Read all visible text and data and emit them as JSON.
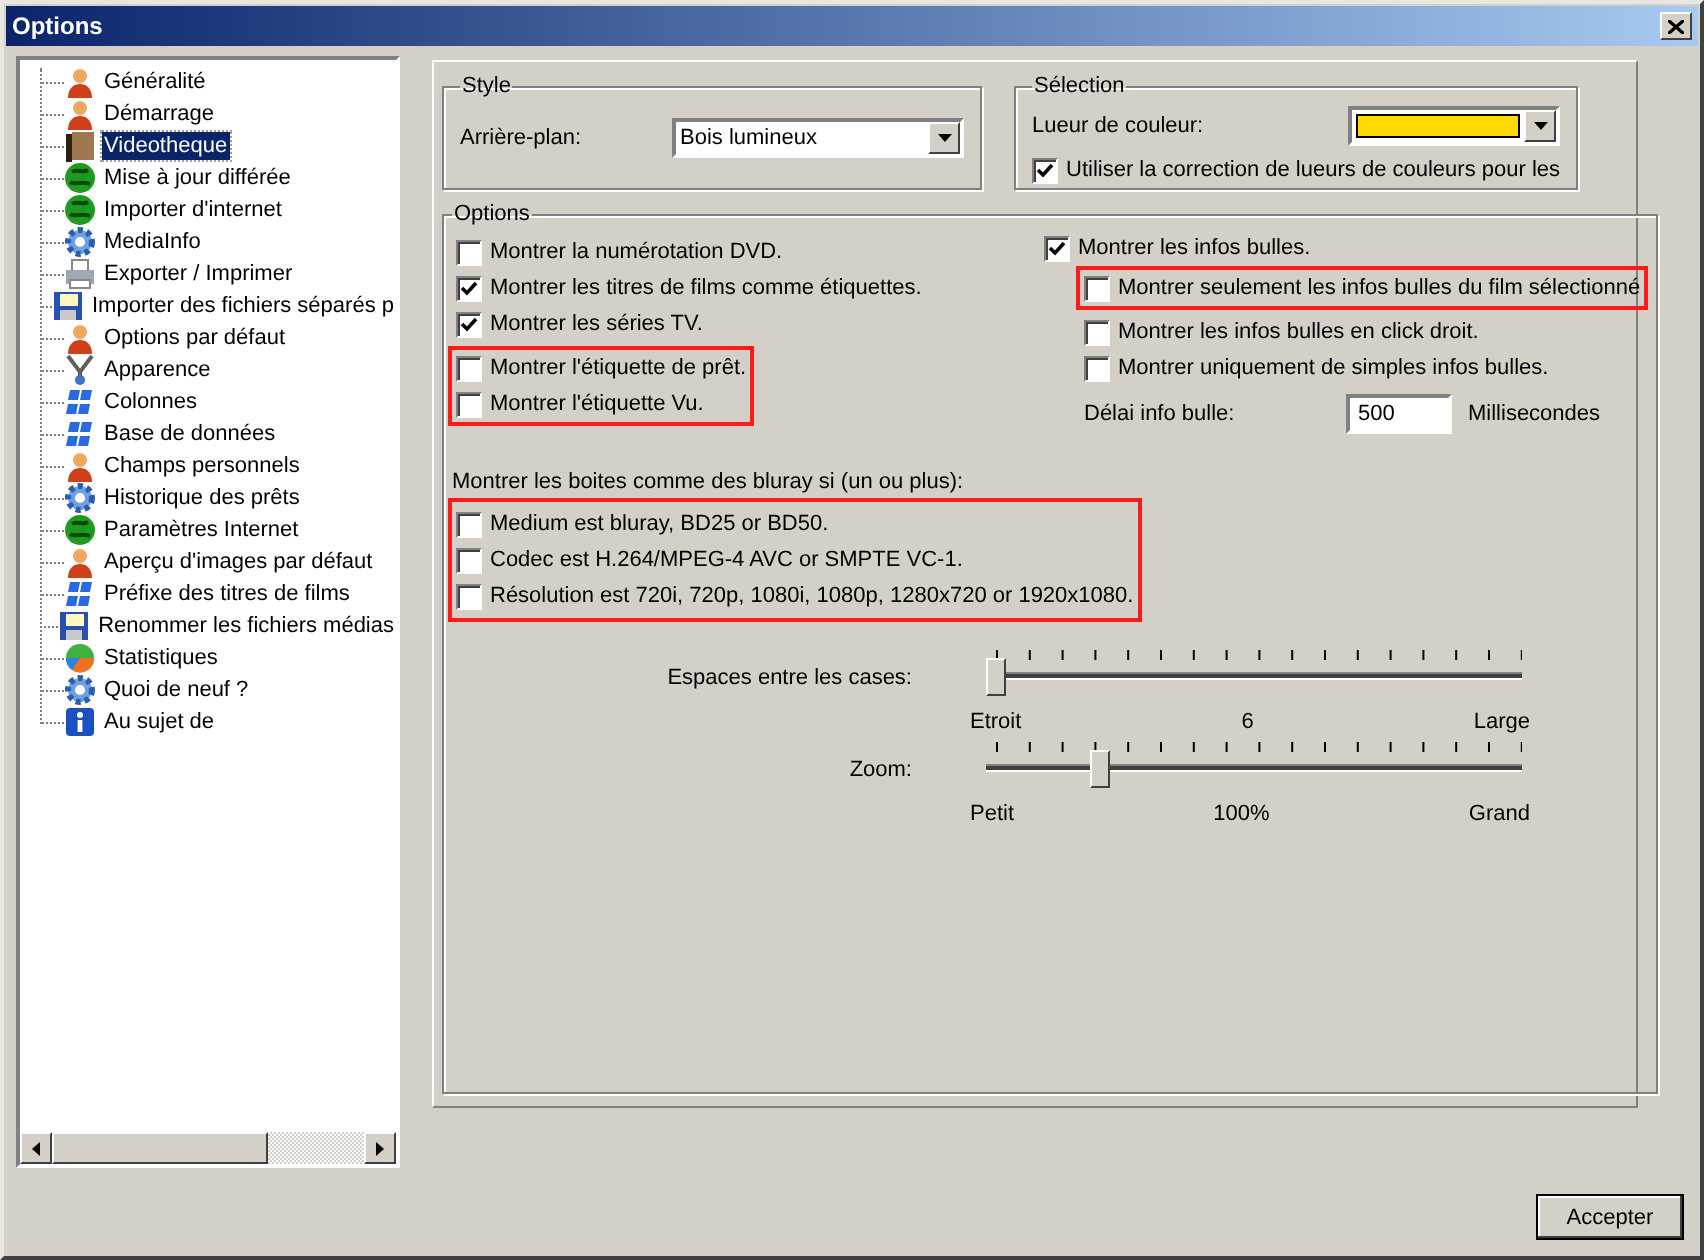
{
  "window": {
    "title": "Options"
  },
  "tree": {
    "items": [
      {
        "label": "Généralité",
        "kind": "person",
        "selected": false
      },
      {
        "label": "Démarrage",
        "kind": "person",
        "selected": false
      },
      {
        "label": "Videotheque",
        "kind": "film",
        "selected": true
      },
      {
        "label": "Mise à jour différée",
        "kind": "globe",
        "selected": false
      },
      {
        "label": "Importer d'internet",
        "kind": "globe",
        "selected": false
      },
      {
        "label": "MediaInfo",
        "kind": "gear",
        "selected": false
      },
      {
        "label": "Exporter / Imprimer",
        "kind": "printer",
        "selected": false
      },
      {
        "label": "Importer des fichiers séparés p",
        "kind": "floppy",
        "selected": false
      },
      {
        "label": "Options par défaut",
        "kind": "person",
        "selected": false
      },
      {
        "label": "Apparence",
        "kind": "tools",
        "selected": false
      },
      {
        "label": "Colonnes",
        "kind": "windows",
        "selected": false
      },
      {
        "label": "Base de données",
        "kind": "windows",
        "selected": false
      },
      {
        "label": "Champs personnels",
        "kind": "person",
        "selected": false
      },
      {
        "label": "Historique des prêts",
        "kind": "gear",
        "selected": false
      },
      {
        "label": "Paramètres Internet",
        "kind": "globe",
        "selected": false
      },
      {
        "label": "Aperçu d'images par défaut",
        "kind": "person",
        "selected": false
      },
      {
        "label": "Préfixe des titres de films",
        "kind": "windows",
        "selected": false
      },
      {
        "label": "Renommer les fichiers médias",
        "kind": "floppy",
        "selected": false
      },
      {
        "label": "Statistiques",
        "kind": "pie",
        "selected": false
      },
      {
        "label": "Quoi de neuf ?",
        "kind": "gear",
        "selected": false
      },
      {
        "label": "Au sujet de",
        "kind": "info",
        "selected": false
      }
    ]
  },
  "style_group": {
    "title": "Style",
    "label": "Arrière-plan:",
    "value": "Bois lumineux"
  },
  "selection_group": {
    "title": "Sélection",
    "label": "Lueur de couleur:",
    "color": "#ffd800",
    "checkbox": {
      "label": "Utiliser la correction de lueurs de couleurs pour les",
      "checked": true
    }
  },
  "options_group": {
    "title": "Options",
    "left_groups": [
      {
        "highlighted": false,
        "items": [
          {
            "label": "Montrer la numérotation DVD.",
            "checked": false
          },
          {
            "label": "Montrer les titres de films comme étiquettes.",
            "checked": true
          },
          {
            "label": "Montrer les séries TV.",
            "checked": true
          }
        ]
      },
      {
        "highlighted": true,
        "items": [
          {
            "label": "Montrer l'étiquette de prêt.",
            "checked": false
          },
          {
            "label": "Montrer l'étiquette Vu.",
            "checked": false
          }
        ]
      }
    ],
    "tooltips": {
      "label": "Montrer les infos bulles.",
      "checked": true,
      "groups": [
        {
          "highlighted": true,
          "items": [
            {
              "label": "Montrer seulement les infos bulles du film sélectionné",
              "checked": false
            }
          ]
        },
        {
          "highlighted": false,
          "items": [
            {
              "label": "Montrer les infos bulles en click droit.",
              "checked": false
            },
            {
              "label": "Montrer uniquement de simples infos bulles.",
              "checked": false
            }
          ]
        }
      ]
    },
    "delay": {
      "label": "Délai info bulle:",
      "value": "500",
      "unit": "Millisecondes"
    },
    "bluray": {
      "heading": "Montrer les boites comme des bluray si (un ou plus):",
      "groups": [
        {
          "highlighted": true,
          "items": [
            {
              "label": "Medium est bluray, BD25 or BD50.",
              "checked": false
            },
            {
              "label": "Codec est H.264/MPEG-4 AVC or SMPTE VC-1.",
              "checked": false
            },
            {
              "label": "Résolution est 720i, 720p, 1080i, 1080p, 1280x720 or 1920x1080.",
              "checked": false
            }
          ]
        }
      ]
    },
    "sliders": [
      {
        "label": "Espaces entre les cases:",
        "level": 0,
        "min_label": "Etroit",
        "value_label": "6",
        "max_label": "Large"
      },
      {
        "label": "Zoom:",
        "level": 0.2,
        "min_label": "Petit",
        "value_label": "100%",
        "max_label": "Grand"
      }
    ]
  },
  "buttons": [
    {
      "label": "Accepter"
    }
  ]
}
